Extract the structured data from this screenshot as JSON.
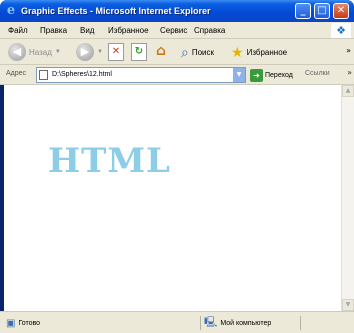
{
  "window": {
    "title": "Graphic Effects - Microsoft Internet Explorer",
    "controls": {
      "minimize": "_",
      "maximize": "□",
      "close": "✕"
    }
  },
  "menu": {
    "items": [
      "Файл",
      "Правка",
      "Вид",
      "Избранное",
      "Сервис",
      "Справка"
    ]
  },
  "toolbar": {
    "back_label": "Назад",
    "search_label": "Поиск",
    "favorites_label": "Избранное"
  },
  "address": {
    "label": "Адрес",
    "value": "D:\\Spheres\\12.html",
    "go_label": "Переход",
    "links_label": "Ссылки"
  },
  "content": {
    "heading": "HTML"
  },
  "status": {
    "text": "Готово",
    "zone": "Мой компьютер"
  },
  "colors": {
    "titlebar": "#0349d6",
    "chrome": "#ece9d8",
    "heading": "#8ccde8"
  }
}
